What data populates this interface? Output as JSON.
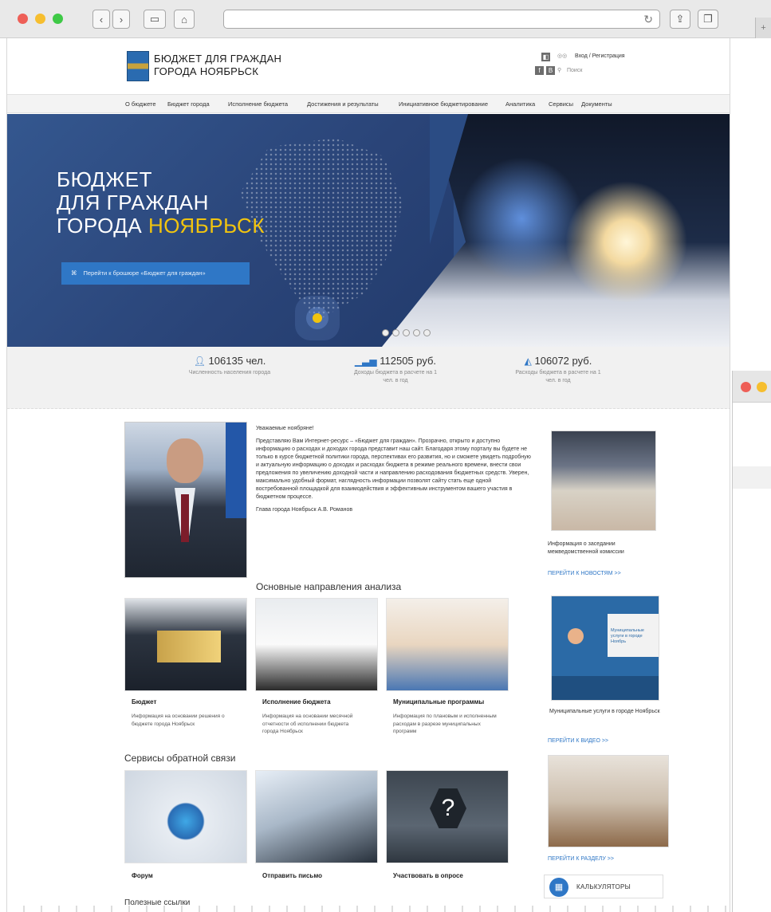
{
  "browser": {
    "traffic_colors": [
      "#ee5f57",
      "#f6be2f",
      "#3ec946"
    ],
    "back_icon": "chevron-left-icon",
    "forward_icon": "chevron-right-icon",
    "sidebar_icon": "sidebar-icon",
    "home_icon": "home-icon",
    "reload_icon": "reload-icon",
    "share_icon": "share-icon",
    "tabs_icon": "tabs-icon"
  },
  "header": {
    "title_line1": "БЮДЖЕТ ДЛЯ ГРАЖДАН",
    "title_line2": "ГОРОДА НОЯБРЬСК",
    "login": "Вход / Регистрация",
    "search": "Поиск"
  },
  "nav": {
    "items": [
      "О бюджете",
      "Бюджет города",
      "Исполнение бюджета",
      "Достижения и результаты",
      "Инициативное бюджетирование",
      "Аналитика",
      "Сервисы",
      "Документы"
    ]
  },
  "hero": {
    "line1": "БЮДЖЕТ",
    "line2": "ДЛЯ ГРАЖДАН",
    "line3_prefix": "ГОРОДА ",
    "line3_accent": "НОЯБРЬСК",
    "button": "Перейти к брошюре «Бюджет для граждан»",
    "accent_color": "#f1c40f"
  },
  "stats": [
    {
      "value": "106135 чел.",
      "caption": "Численность населения города",
      "icon": "person-icon"
    },
    {
      "value": "112505 руб.",
      "caption": "Доходы бюджета в расчете на 1 чел. в год",
      "icon": "bar-chart-icon"
    },
    {
      "value": "106072 руб.",
      "caption": "Расходы бюджета в расчете на 1 чел. в год",
      "icon": "area-chart-icon"
    }
  ],
  "letter": {
    "greeting": "Уважаемые ноябряне!",
    "body": "Представляю Вам Интернет-ресурс – «Бюджет для граждан». Прозрачно, открыто и доступно информацию о расходах и доходах города представит наш сайт. Благодаря этому порталу вы будете не только в курсе бюджетной политики города, перспективах его развития, но и сможете увидеть подробную и актуальную информацию о доходах и расходах бюджета в режиме реального времени, внести свои предложения по увеличению доходной части и направлению расходования бюджетных средств. Уверен, максимально удобный формат, наглядность информации позволят сайту стать еще одной востребованной площадкой для взаимодействия и эффективным инструментом вашего участия в бюджетном процессе.",
    "signature": "Глава города Ноябрьск А.В. Романов"
  },
  "sidebar": {
    "news_caption": "Информация о заседании межведомственной комиссии",
    "news_link": "ПЕРЕЙТИ К НОВОСТЯМ >>",
    "video_banner": "Муниципальные услуги в городе Ноябрь",
    "video_caption": "Муниципальные услуги в городе Ноябрьск",
    "video_link": "ПЕРЕЙТИ К ВИДЕО >>",
    "section_link": "ПЕРЕЙТИ К РАЗДЕЛУ >>",
    "calc_label": "КАЛЬКУЛЯТОРЫ"
  },
  "analysis": {
    "title": "Основные направления анализа",
    "cards": [
      {
        "title": "Бюджет",
        "desc": "Информация на основании решения о бюджете города Ноябрьск"
      },
      {
        "title": "Исполнение бюджета",
        "desc": "Информация на основании месячной отчетности об исполнении бюджета города Ноябрьск"
      },
      {
        "title": "Муниципальные программы",
        "desc": "Информация по плановым и исполненным расходам в разрезе муниципальных программ"
      }
    ]
  },
  "feedback": {
    "title": "Сервисы обратной связи",
    "cards": [
      {
        "title": "Форум"
      },
      {
        "title": "Отправить письмо"
      },
      {
        "title": "Участвовать в опросе"
      }
    ]
  },
  "useful": {
    "title": "Полезные ссылки"
  }
}
